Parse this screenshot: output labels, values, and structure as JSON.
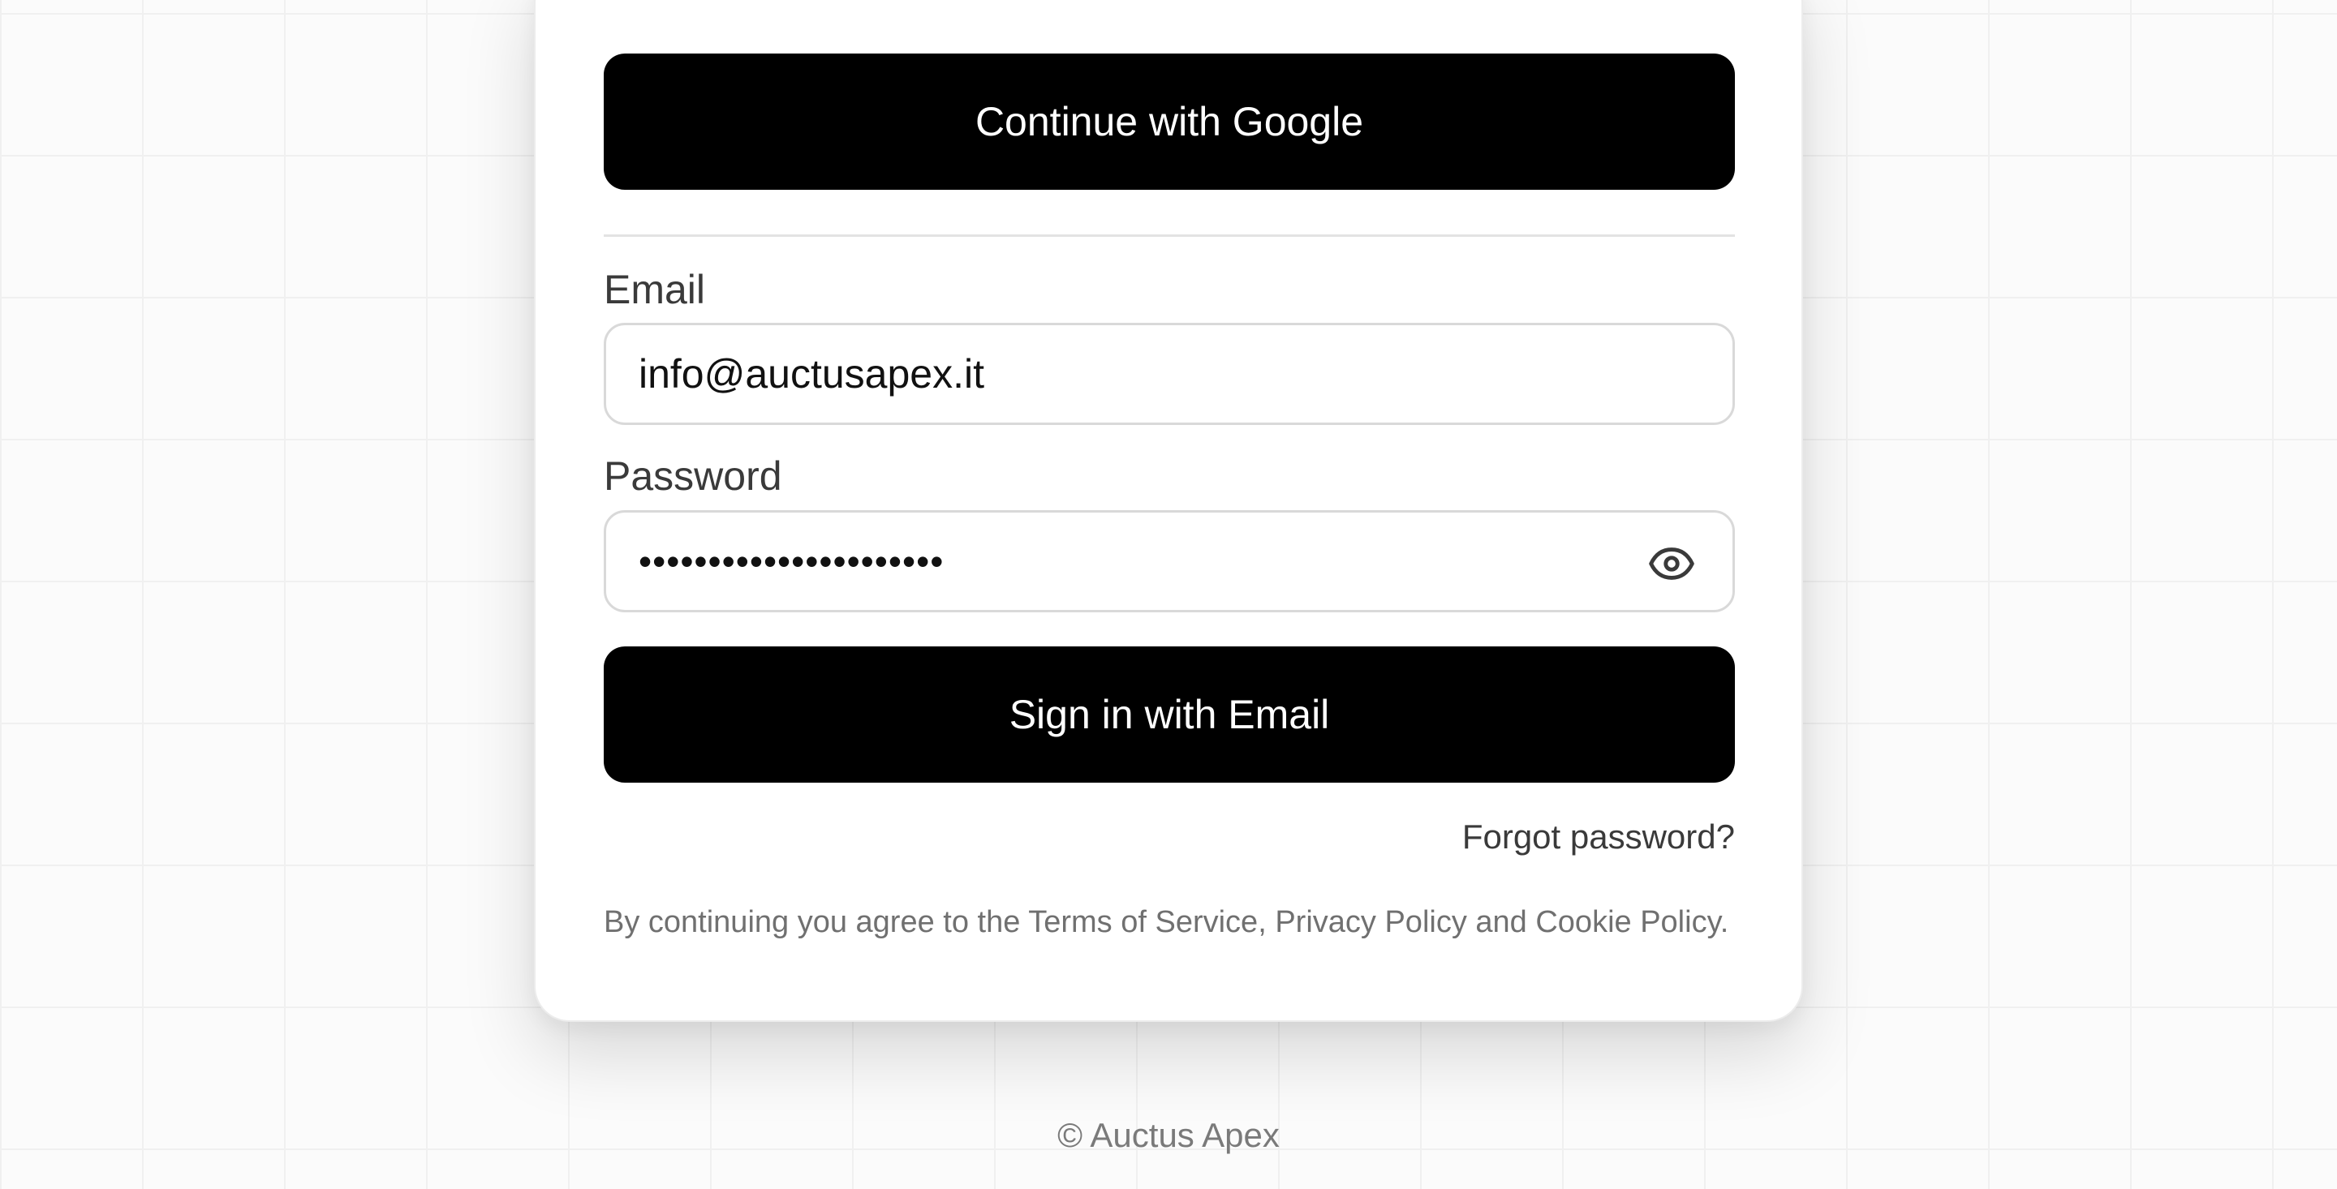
{
  "auth": {
    "google_button_label": "Continue with Google",
    "email_label": "Email",
    "email_value": "info@auctusapex.it",
    "password_label": "Password",
    "password_value": "••••••••••••••••••••••",
    "show_password_icon": "eye-icon",
    "submit_label": "Sign in with Email",
    "forgot_password_label": "Forgot password?"
  },
  "legal": {
    "prefix": "By continuing you agree to the ",
    "terms": "Terms of Service",
    "sep1": ", ",
    "privacy": "Privacy Policy",
    "sep2": " and ",
    "cookie": "Cookie Policy",
    "suffix": "."
  },
  "footer": {
    "copyright": "© Auctus Apex"
  },
  "colors": {
    "button_bg": "#000000",
    "button_text": "#ffffff",
    "field_border": "#d9d9d9",
    "muted_text": "#707070"
  }
}
